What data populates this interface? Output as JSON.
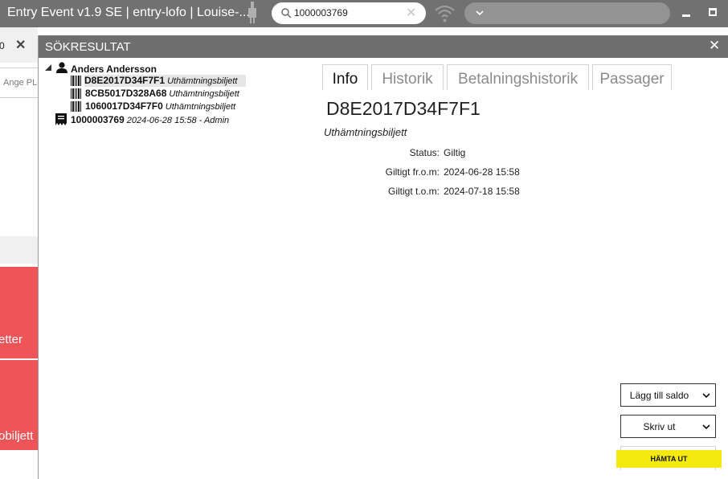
{
  "titlebar": {
    "app_title": "Entry Event v1.9 SE | entry-lofo | Louise-...",
    "search_value": "1000003769",
    "clear_symbol": "✕"
  },
  "background_app": {
    "tab_label": "0",
    "tab_close": "✕",
    "input_placeholder": "Ange PL",
    "red_button_1_label": "etter",
    "red_button_2_label": "obiljett"
  },
  "panel": {
    "title": "SÖKRESULTAT",
    "close_symbol": "✕"
  },
  "tree": {
    "root": "Anders Andersson",
    "tickets": [
      {
        "code": "D8E2017D34F7F1",
        "type": "Uthämtningsbiljett"
      },
      {
        "code": "8CB5017D328A68",
        "type": "Uthämtningsbiljett"
      },
      {
        "code": "1060017D34F7F0",
        "type": "Uthämtningsbiljett"
      }
    ],
    "order": {
      "code": "1000003769",
      "meta": "2024-06-28 15:58 - Admin"
    }
  },
  "tabs": [
    {
      "label": "Info"
    },
    {
      "label": "Historik"
    },
    {
      "label": "Betalningshistorik"
    },
    {
      "label": "Passager"
    }
  ],
  "details": {
    "code": "D8E2017D34F7F1",
    "type": "Uthämtningsbiljett",
    "status_label": "Status:",
    "status_value": "Giltig",
    "valid_from_label": "Giltigt fr.o.m:",
    "valid_from_value": "2024-06-28 15:58",
    "valid_to_label": "Giltigt t.o.m:",
    "valid_to_value": "2024-07-18 15:58"
  },
  "actions": {
    "add_balance": "Lägg till saldo",
    "print": "Skriv ut",
    "fetch": "HÄMTA UT"
  },
  "colors": {
    "titlebar": "#717171",
    "panel_header": "#6e6e6e",
    "accent_red": "#ee5458",
    "highlight_yellow": "#f5ea10"
  },
  "icons": [
    "plug-icon",
    "search-icon",
    "clear-icon",
    "wifi-icon",
    "chevron-down-icon",
    "minimize-icon",
    "maximize-icon",
    "close-icon",
    "person-icon",
    "barcode-icon",
    "receipt-icon"
  ]
}
